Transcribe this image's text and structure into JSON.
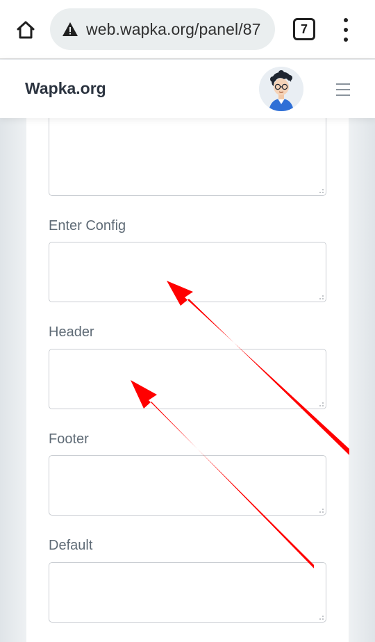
{
  "browser": {
    "url": "web.wapka.org/panel/87",
    "tab_count": "7",
    "icons": {
      "home": "home-icon",
      "security": "warning-triangle-icon",
      "tabs": "tab-switcher-icon",
      "menu": "kebab-menu-icon"
    }
  },
  "site": {
    "brand": "Wapka.org",
    "avatar": "avatar-icon",
    "menu_icon": "hamburger-icon"
  },
  "form": {
    "fields": [
      {
        "label": "",
        "value": ""
      },
      {
        "label": "Enter Config",
        "value": ""
      },
      {
        "label": "Header",
        "value": ""
      },
      {
        "label": "Footer",
        "value": ""
      },
      {
        "label": "Default",
        "value": ""
      }
    ]
  },
  "annotations": {
    "arrow_color": "#ff0000",
    "arrows": [
      "arrow-to-enter-config",
      "arrow-to-header"
    ]
  },
  "colors": {
    "label_text": "#5f6b76",
    "brand_text": "#2c3440",
    "url_pill": "#eaeeef"
  }
}
